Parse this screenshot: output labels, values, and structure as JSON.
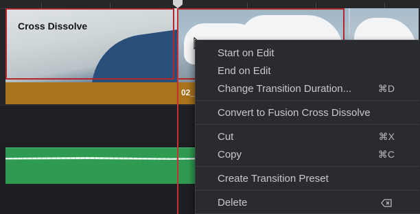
{
  "timeline": {
    "transition_label": "Cross Dissolve",
    "clip_name": "02_"
  },
  "context_menu": {
    "items": [
      {
        "label": "Start on Edit",
        "shortcut": ""
      },
      {
        "label": "End on Edit",
        "shortcut": ""
      },
      {
        "label": "Change Transition Duration...",
        "shortcut": "⌘D"
      },
      {
        "label": "Convert to Fusion Cross Dissolve",
        "shortcut": ""
      },
      {
        "label": "Cut",
        "shortcut": "⌘X"
      },
      {
        "label": "Copy",
        "shortcut": "⌘C"
      },
      {
        "label": "Create Transition Preset",
        "shortcut": ""
      },
      {
        "label": "Delete",
        "shortcut": ""
      }
    ]
  },
  "colors": {
    "transition_border": "#b3262b",
    "video_clip_header": "#a8731c",
    "audio_clip": "#2f9b52",
    "playhead": "#c62f33",
    "menu_bg": "#2a2b2e"
  }
}
